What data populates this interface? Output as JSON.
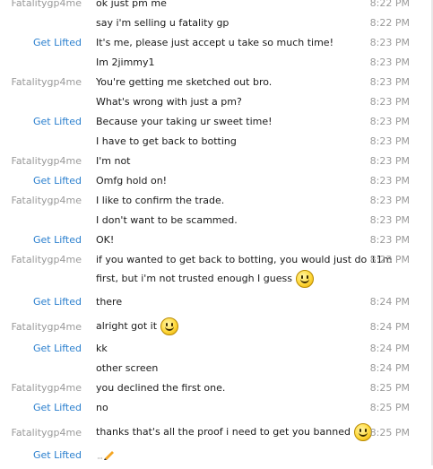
{
  "messages": [
    {
      "sender": "Fatalitygp4me",
      "text": "ok just pm me",
      "time": "8:22 PM",
      "me": false,
      "smiley": false
    },
    {
      "sender": "",
      "text": "say i'm selling u fatality gp",
      "time": "8:22 PM",
      "me": false,
      "smiley": false
    },
    {
      "sender": "Get Lifted",
      "text": "It's me, please just accept u take so much time!",
      "time": "8:23 PM",
      "me": true,
      "smiley": false
    },
    {
      "sender": "",
      "text": "Im 2jimmy1",
      "time": "8:23 PM",
      "me": true,
      "smiley": false
    },
    {
      "sender": "Fatalitygp4me",
      "text": "You're getting me sketched out bro.",
      "time": "8:23 PM",
      "me": false,
      "smiley": false
    },
    {
      "sender": "",
      "text": "What's wrong with just a pm?",
      "time": "8:23 PM",
      "me": false,
      "smiley": false
    },
    {
      "sender": "Get Lifted",
      "text": "Because your taking ur sweet time!",
      "time": "8:23 PM",
      "me": true,
      "smiley": false
    },
    {
      "sender": "",
      "text": "I have to get back to botting",
      "time": "8:23 PM",
      "me": true,
      "smiley": false
    },
    {
      "sender": "Fatalitygp4me",
      "text": "I'm not",
      "time": "8:23 PM",
      "me": false,
      "smiley": false
    },
    {
      "sender": "Get Lifted",
      "text": "Omfg hold on!",
      "time": "8:23 PM",
      "me": true,
      "smiley": false
    },
    {
      "sender": "Fatalitygp4me",
      "text": "I like to confirm the trade.",
      "time": "8:23 PM",
      "me": false,
      "smiley": false
    },
    {
      "sender": "",
      "text": "I don't want to be scammed.",
      "time": "8:23 PM",
      "me": false,
      "smiley": false
    },
    {
      "sender": "Get Lifted",
      "text": "OK!",
      "time": "8:23 PM",
      "me": true,
      "smiley": false
    },
    {
      "sender": "Fatalitygp4me",
      "text": "if you wanted to get back to botting, you would just do 11m",
      "time": "8:23 PM",
      "me": false,
      "smiley": false
    },
    {
      "sender": "",
      "text": "first, but i'm not trusted enough I guess",
      "time": "",
      "me": false,
      "smiley": true
    },
    {
      "sender": "Get Lifted",
      "text": "there",
      "time": "8:24 PM",
      "me": true,
      "smiley": false
    },
    {
      "sender": "Fatalitygp4me",
      "text": "alright got it",
      "time": "8:24 PM",
      "me": false,
      "smiley": true
    },
    {
      "sender": "Get Lifted",
      "text": "kk",
      "time": "8:24 PM",
      "me": true,
      "smiley": false
    },
    {
      "sender": "",
      "text": "other screen",
      "time": "8:24 PM",
      "me": true,
      "smiley": false
    },
    {
      "sender": "Fatalitygp4me",
      "text": "you declined the first one.",
      "time": "8:25 PM",
      "me": false,
      "smiley": false
    },
    {
      "sender": "Get Lifted",
      "text": "no",
      "time": "8:25 PM",
      "me": true,
      "smiley": false
    },
    {
      "sender": "Fatalitygp4me",
      "text": "thanks that's all the proof i need to get you banned",
      "time": "8:25 PM",
      "me": false,
      "smiley": true
    },
    {
      "sender": "Get Lifted",
      "text": "",
      "time": "",
      "me": true,
      "smiley": false,
      "typing": true
    }
  ]
}
